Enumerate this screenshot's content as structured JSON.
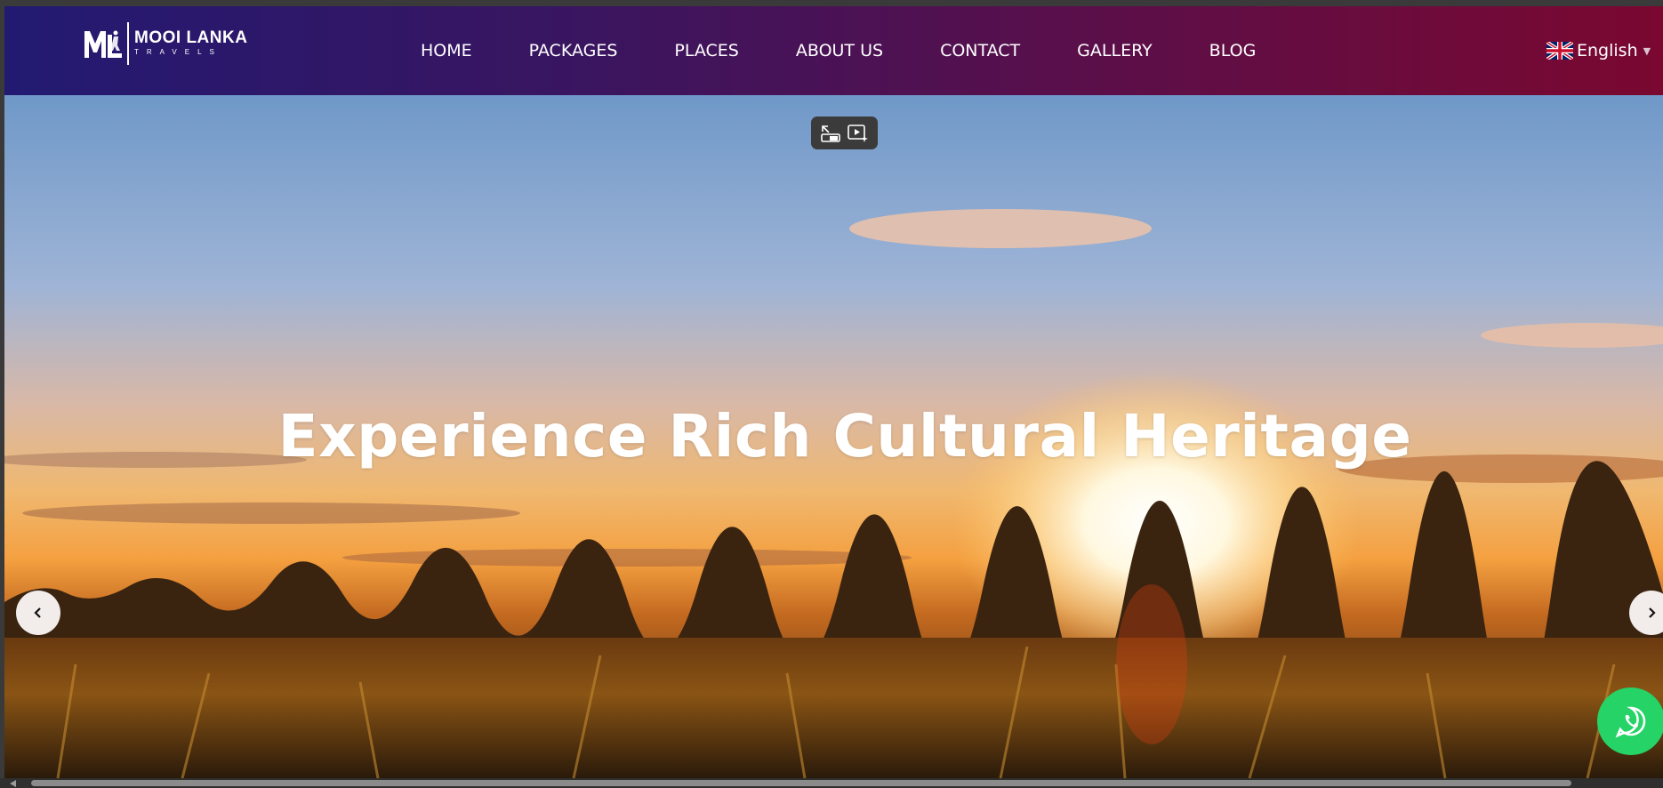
{
  "brand": {
    "name": "MOOI LANKA",
    "tagline": "TRAVELS",
    "mark_letters": "ML"
  },
  "nav": {
    "items": [
      {
        "label": "HOME"
      },
      {
        "label": "PACKAGES"
      },
      {
        "label": "PLACES"
      },
      {
        "label": "ABOUT US"
      },
      {
        "label": "CONTACT"
      },
      {
        "label": "GALLERY"
      },
      {
        "label": "BLOG"
      }
    ]
  },
  "language": {
    "selected": "English",
    "flag_icon": "uk-flag-icon"
  },
  "hero": {
    "headline": "Experience Rich Cultural Heritage",
    "prev_icon": "chevron-left-icon",
    "next_icon": "chevron-right-icon"
  },
  "overlay": {
    "pip_icons": [
      "exit-pip-icon",
      "play-sparkle-icon"
    ]
  },
  "floating": {
    "whatsapp_icon": "whatsapp-icon"
  },
  "colors": {
    "nav_gradient_start": "#221a72",
    "nav_gradient_end": "#7a0830",
    "whatsapp_green": "#25d366"
  }
}
